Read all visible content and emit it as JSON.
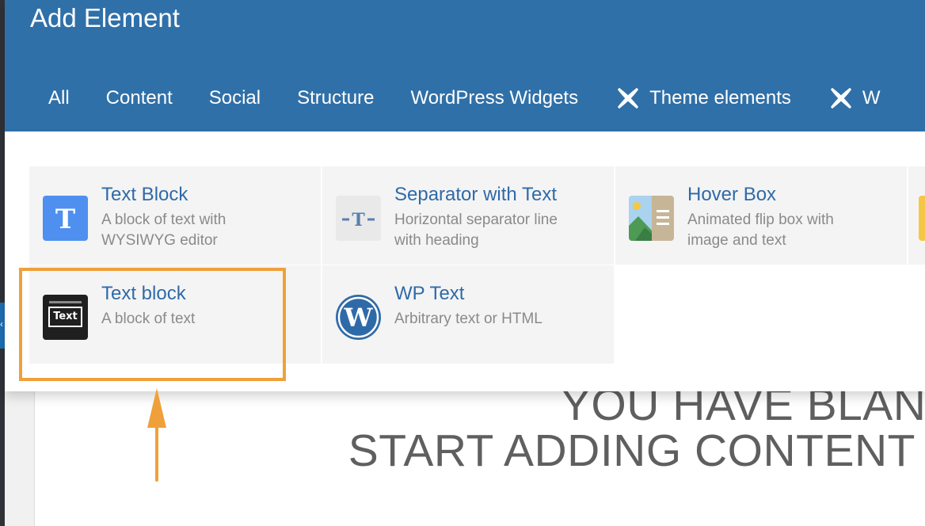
{
  "modal": {
    "title": "Add Element",
    "tabs": [
      {
        "label": "All"
      },
      {
        "label": "Content"
      },
      {
        "label": "Social"
      },
      {
        "label": "Structure"
      },
      {
        "label": "WordPress Widgets"
      },
      {
        "label": "Theme elements",
        "icon": "theme-x-icon"
      },
      {
        "label": "W",
        "icon": "theme-x-icon"
      }
    ]
  },
  "elements": [
    {
      "title": "Text Block",
      "desc1": "A block of text with",
      "desc2": "WYSIWYG editor",
      "icon": "text-t-icon"
    },
    {
      "title": "Separator with Text",
      "desc1": "Horizontal separator line",
      "desc2": "with heading",
      "icon": "separator-t-icon"
    },
    {
      "title": "Hover Box",
      "desc1": "Animated flip box with",
      "desc2": "image and text",
      "icon": "hover-box-icon"
    },
    {
      "title": "Text block",
      "desc1": "A block of text",
      "icon": "text-block-icon",
      "icon_label": "Text"
    },
    {
      "title": "WP Text",
      "desc1": "Arbitrary text or HTML",
      "icon": "wordpress-icon"
    }
  ],
  "background": {
    "line1": "YOU HAVE BLANK",
    "line2": "START ADDING CONTENT"
  },
  "colors": {
    "header": "#3070a8",
    "link": "#2f6aa8",
    "highlight": "#f0a03a"
  }
}
